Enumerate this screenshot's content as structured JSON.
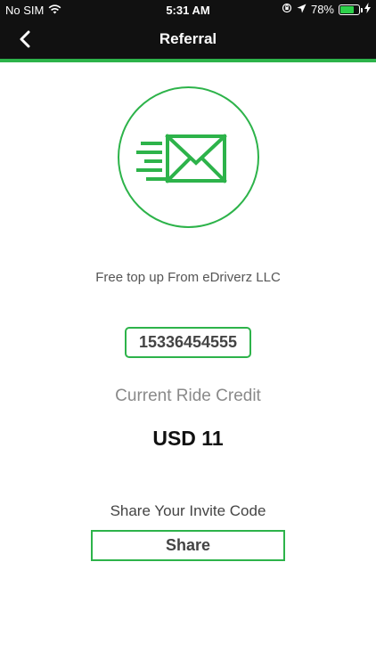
{
  "status_bar": {
    "carrier": "No SIM",
    "time": "5:31 AM",
    "battery_percent": "78%",
    "battery_level": 0.78,
    "icons": [
      "wifi-icon",
      "orientation-lock-icon",
      "location-arrow-icon",
      "battery-icon",
      "charging-bolt-icon"
    ]
  },
  "nav": {
    "title": "Referral",
    "back_icon": "chevron-left-icon"
  },
  "colors": {
    "accent": "#2db34a",
    "header_bg": "#111111"
  },
  "hero": {
    "icon": "envelope-icon"
  },
  "promo": {
    "text": "Free top up From eDriverz LLC"
  },
  "invite": {
    "code": "15336454555"
  },
  "credit": {
    "label": "Current Ride Credit",
    "value": "USD 11"
  },
  "share": {
    "label": "Share Your Invite Code",
    "button_label": "Share"
  }
}
